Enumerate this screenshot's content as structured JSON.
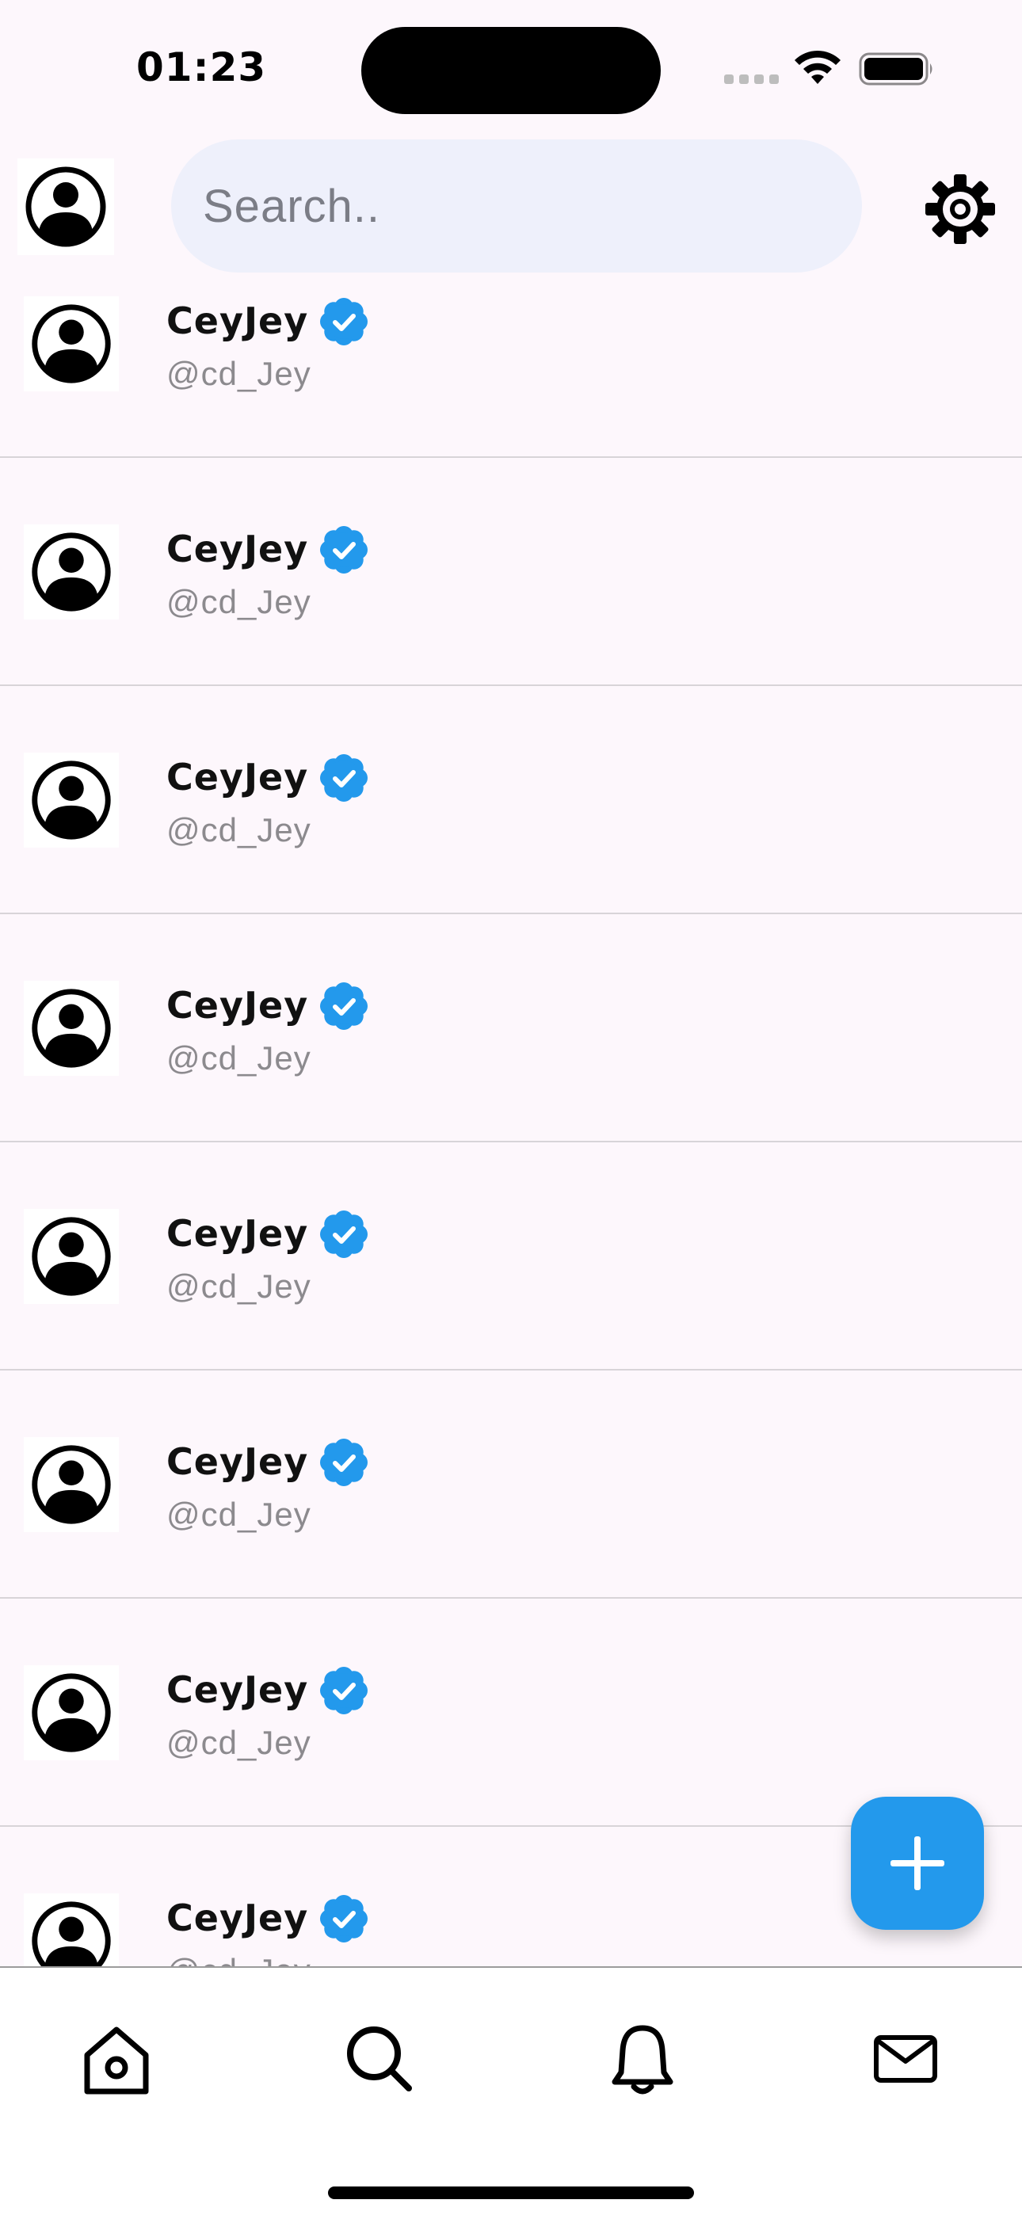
{
  "status_bar": {
    "time": "01:23",
    "wifi_icon": "wifi-icon",
    "battery_icon": "battery-full-icon",
    "signal_icon": "cellular-signal-icon"
  },
  "header": {
    "avatar_icon": "account-circle-icon",
    "search": {
      "placeholder": "Search..",
      "value": ""
    },
    "settings_icon": "gear-icon"
  },
  "users": [
    {
      "name": "CeyJey",
      "handle": "@cd_Jey",
      "verified": true
    },
    {
      "name": "CeyJey",
      "handle": "@cd_Jey",
      "verified": true
    },
    {
      "name": "CeyJey",
      "handle": "@cd_Jey",
      "verified": true
    },
    {
      "name": "CeyJey",
      "handle": "@cd_Jey",
      "verified": true
    },
    {
      "name": "CeyJey",
      "handle": "@cd_Jey",
      "verified": true
    },
    {
      "name": "CeyJey",
      "handle": "@cd_Jey",
      "verified": true
    },
    {
      "name": "CeyJey",
      "handle": "@cd_Jey",
      "verified": true
    },
    {
      "name": "CeyJey",
      "handle": "@cd_Jey",
      "verified": true
    }
  ],
  "fab": {
    "icon": "plus-icon"
  },
  "bottom_nav": {
    "items": [
      {
        "icon": "home-icon"
      },
      {
        "icon": "search-icon"
      },
      {
        "icon": "bell-icon"
      },
      {
        "icon": "mail-icon"
      }
    ]
  },
  "colors": {
    "background": "#FDF7FC",
    "search_background": "#EEF0FB",
    "accent": "#2399EC",
    "verified": "#2399EC",
    "handle_text": "#8C8A8E",
    "divider": "#D8D4D8"
  }
}
